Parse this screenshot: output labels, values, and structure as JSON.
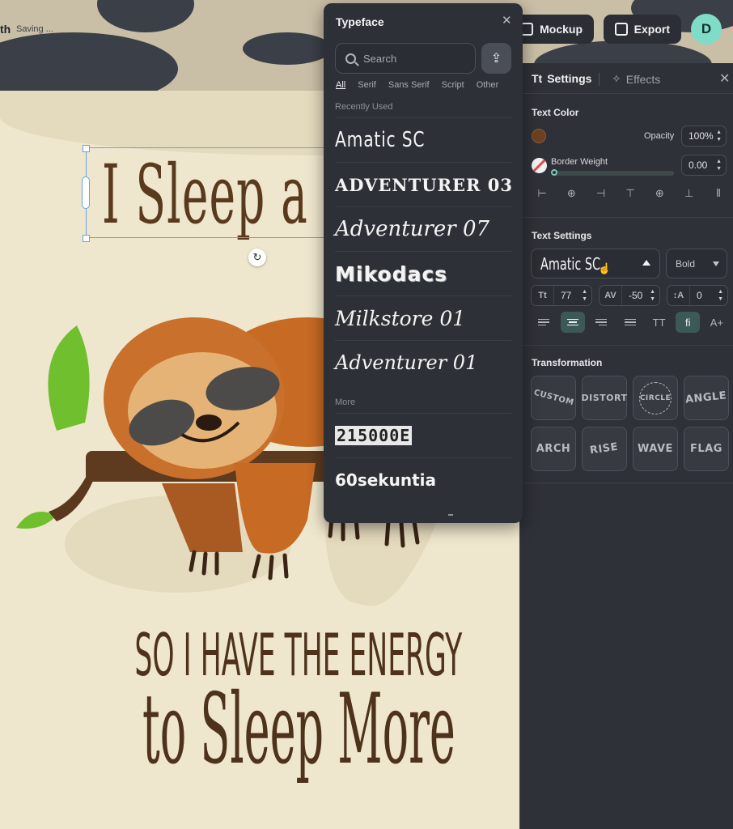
{
  "header": {
    "title_fragment": "th",
    "status": "Saving ...",
    "mockup_label": "Mockup",
    "export_label": "Export",
    "avatar_initial": "D"
  },
  "canvas": {
    "headline": "I Sleep a",
    "line2": "SO I HAVE THE ENERGY",
    "line3": "to Sleep More"
  },
  "typeface": {
    "title": "Typeface",
    "search_placeholder": "Search",
    "tabs": [
      "All",
      "Serif",
      "Sans Serif",
      "Script",
      "Other"
    ],
    "recent_label": "Recently Used",
    "recent": [
      "Amatic SC",
      "ADVENTURER 03",
      "Adventurer 07",
      "Mikodacs",
      "Milkstore 01",
      "Adventurer 01"
    ],
    "more_label": "More",
    "more": [
      "215000E",
      "60sekuntia"
    ]
  },
  "panel": {
    "tab_settings": "Settings",
    "tab_effects": "Effects",
    "text_color_label": "Text Color",
    "opacity_label": "Opacity",
    "opacity_value": "100%",
    "border_weight_label": "Border Weight",
    "border_weight_value": "0.00",
    "text_settings_label": "Text Settings",
    "font_value": "Amatic SC",
    "weight_value": "Bold",
    "font_size": "77",
    "letter_spacing": "-50",
    "line_height": "0",
    "transformation_label": "Transformation",
    "transformations": [
      "CUSTOM",
      "DISTORT",
      "CIRCLE",
      "ANGLE",
      "ARCH",
      "RISE",
      "WAVE",
      "FLAG"
    ]
  },
  "colors": {
    "accent": "#3c5957",
    "text_color": "#6b4121",
    "avatar": "#7fdcc9"
  }
}
